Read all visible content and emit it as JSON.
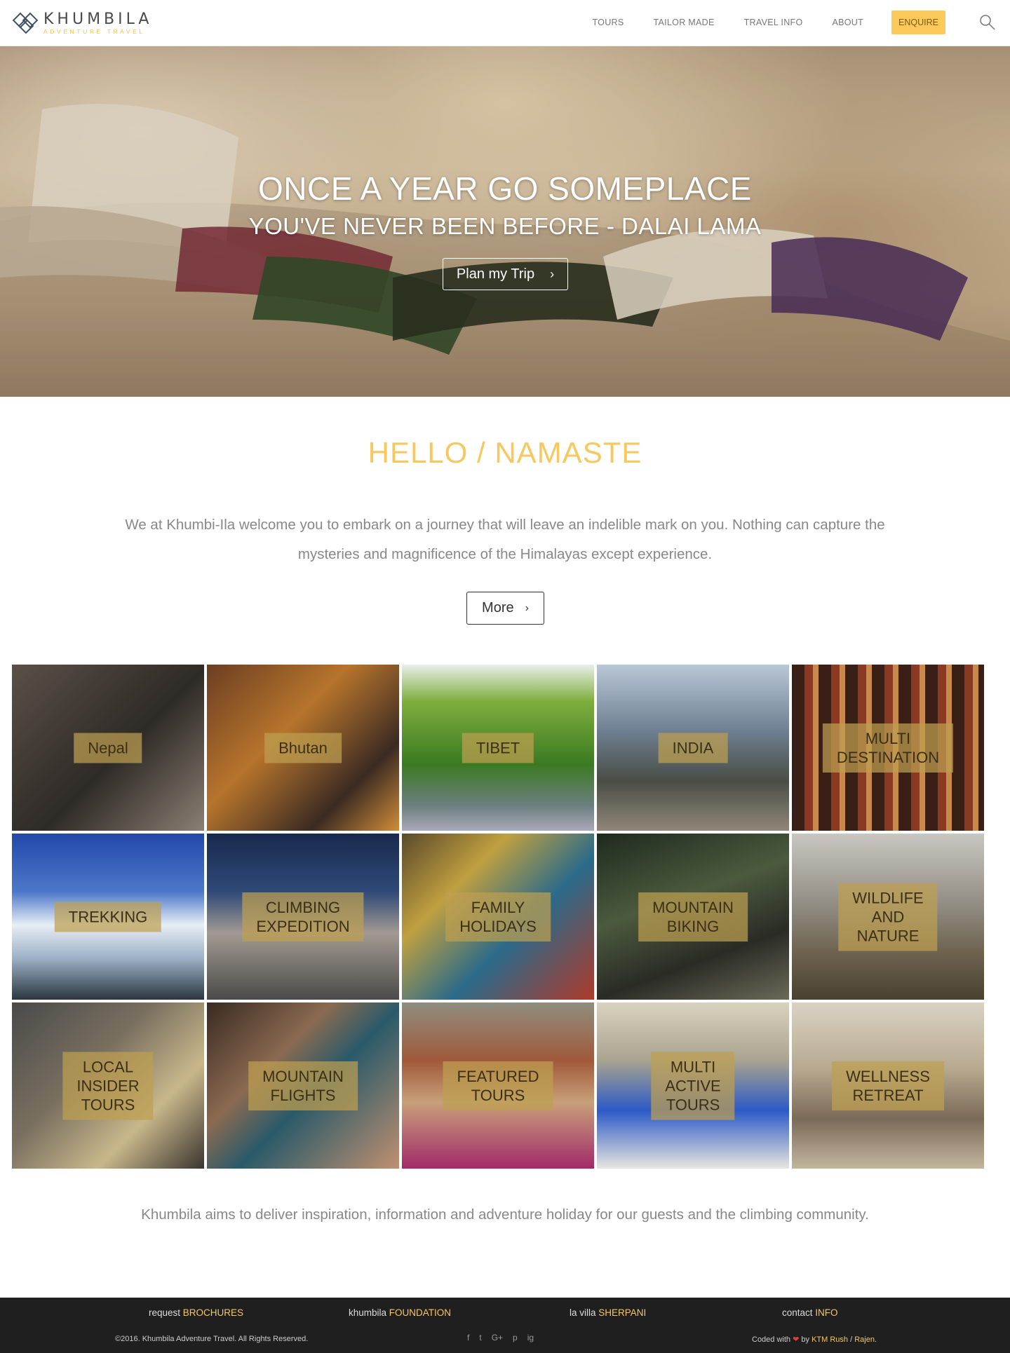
{
  "header": {
    "logo": {
      "name": "KHUMBILA",
      "tagline": "ADVENTURE TRAVEL"
    },
    "nav": [
      {
        "label": "TOURS"
      },
      {
        "label": "TAILOR MADE"
      },
      {
        "label": "TRAVEL INFO"
      },
      {
        "label": "ABOUT"
      }
    ],
    "enquire_label": "ENQUIRE",
    "search_icon": "search-icon"
  },
  "hero": {
    "title": "ONCE A YEAR GO SOMEPLACE",
    "subtitle": "YOU'VE NEVER BEEN BEFORE - DALAI LAMA",
    "button_label": "Plan my Trip",
    "button_icon": "chevron-right-icon"
  },
  "intro": {
    "title": "HELLO / NAMASTE",
    "text": "We at Khumbi-Ila welcome you to embark on a journey that will leave an indelible mark on you. Nothing can capture the mysteries and magnificence of the Himalayas except experience.",
    "button_label": "More",
    "button_icon": "chevron-right-icon"
  },
  "tiles": [
    {
      "label": "Nepal"
    },
    {
      "label": "Bhutan"
    },
    {
      "label": "TIBET"
    },
    {
      "label": "INDIA"
    },
    {
      "label": "MULTI\nDESTINATION"
    },
    {
      "label": "TREKKING"
    },
    {
      "label": "CLIMBING\nEXPEDITION"
    },
    {
      "label": "FAMILY\nHOLIDAYS"
    },
    {
      "label": "MOUNTAIN\nBIKING"
    },
    {
      "label": "WILDLIFE\nAND\nNATURE"
    },
    {
      "label": "LOCAL\nINSIDER\nTOURS"
    },
    {
      "label": "MOUNTAIN\nFLIGHTS"
    },
    {
      "label": "FEATURED\nTOURS"
    },
    {
      "label": "MULTI\nACTIVE\nTOURS"
    },
    {
      "label": "WELLNESS\nRETREAT"
    }
  ],
  "outro": {
    "text": "Khumbila aims to deliver inspiration, information and adventure holiday for our guests and the climbing community."
  },
  "footer": {
    "links": [
      {
        "prefix": "request",
        "highlight": "BROCHURES"
      },
      {
        "prefix": "khumbila",
        "highlight": "FOUNDATION"
      },
      {
        "prefix": "la villa",
        "highlight": "SHERPANI"
      },
      {
        "prefix": "contact",
        "highlight": "INFO"
      }
    ],
    "copyright": "©2016. Khumbila Adventure Travel. All Rights Reserved.",
    "social": [
      "f",
      "t",
      "G+",
      "p",
      "ig"
    ],
    "credit": {
      "prefix": "Coded with",
      "by": "by",
      "author1": "KTM Rush",
      "sep": "/",
      "author2": "Rajen",
      "end": "."
    }
  },
  "colors": {
    "accent": "#f7c85f",
    "enquire_bg": "#fdc95b",
    "footer_bg": "#1f1f1f",
    "text_muted": "#888888"
  }
}
